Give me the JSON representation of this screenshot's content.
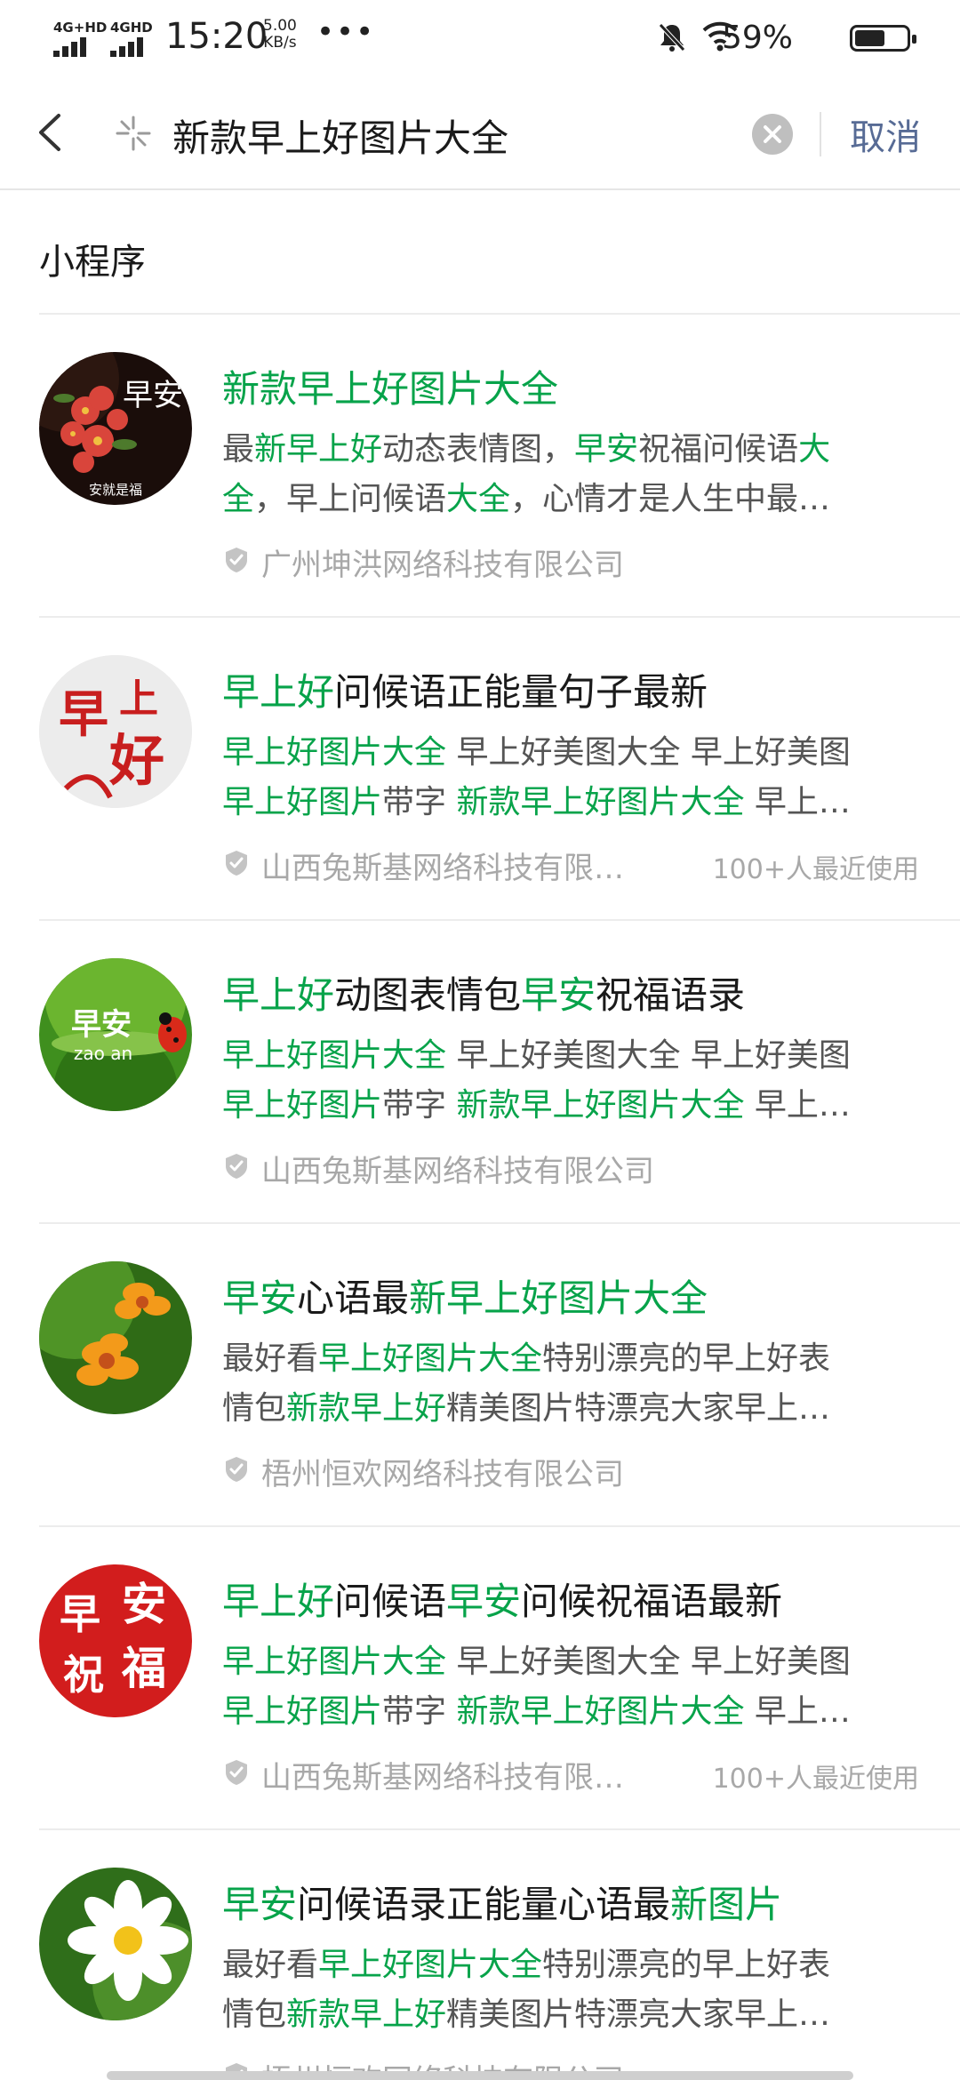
{
  "status_bar": {
    "network_1": "4G+HD",
    "network_2": "4GHD",
    "time": "15:20",
    "speed_value": "5.00",
    "speed_unit": "KB/s",
    "more": "•••",
    "battery_percent": "59%",
    "battery_level": 0.59
  },
  "search": {
    "query": "新款早上好图片大全",
    "cancel_label": "取消"
  },
  "section": {
    "title": "小程序"
  },
  "colors": {
    "highlight": "#07a34a",
    "link": "#576b95",
    "meta": "#a8a8a8"
  },
  "results": [
    {
      "icon": "red-flower-avatar",
      "avatar_text": "早安",
      "avatar_sub": "安就是福",
      "title": [
        {
          "t": "新款早上好图片大全",
          "hl": true
        }
      ],
      "desc": [
        [
          {
            "t": "最",
            "hl": false
          },
          {
            "t": "新早上好",
            "hl": true
          },
          {
            "t": "动态表情图，",
            "hl": false
          },
          {
            "t": "早安",
            "hl": true
          },
          {
            "t": "祝福问候语",
            "hl": false
          },
          {
            "t": "大",
            "hl": true
          }
        ],
        [
          {
            "t": "全",
            "hl": true
          },
          {
            "t": "，早上问候语",
            "hl": false
          },
          {
            "t": "大全",
            "hl": true
          },
          {
            "t": "，心情才是人生中最…",
            "hl": false
          }
        ]
      ],
      "company": "广州坤洪网络科技有限公司",
      "usage": ""
    },
    {
      "icon": "calligraphy-avatar",
      "avatar_text": "早上好",
      "avatar_sub": "",
      "title": [
        {
          "t": "早上好",
          "hl": true
        },
        {
          "t": "问候语正能量句子最新",
          "hl": false
        }
      ],
      "desc": [
        [
          {
            "t": "早上好图片大全",
            "hl": true
          },
          {
            "t": " 早上好美图大全 早上好美图",
            "hl": false
          }
        ],
        [
          {
            "t": "早上好图片",
            "hl": true
          },
          {
            "t": "带字 ",
            "hl": false
          },
          {
            "t": "新款早上好图片大全",
            "hl": true
          },
          {
            "t": " 早上…",
            "hl": false
          }
        ]
      ],
      "company": "山西兔斯基网络科技有限…",
      "usage": "100+人最近使用"
    },
    {
      "icon": "ladybug-avatar",
      "avatar_text": "早安",
      "avatar_sub": "zao an",
      "title": [
        {
          "t": "早上好",
          "hl": true
        },
        {
          "t": "动图表情包",
          "hl": false
        },
        {
          "t": "早安",
          "hl": true
        },
        {
          "t": "祝福语录",
          "hl": false
        }
      ],
      "desc": [
        [
          {
            "t": "早上好图片大全",
            "hl": true
          },
          {
            "t": " 早上好美图大全 早上好美图",
            "hl": false
          }
        ],
        [
          {
            "t": "早上好图片",
            "hl": true
          },
          {
            "t": "带字 ",
            "hl": false
          },
          {
            "t": "新款早上好图片大全",
            "hl": true
          },
          {
            "t": " 早上…",
            "hl": false
          }
        ]
      ],
      "company": "山西兔斯基网络科技有限公司",
      "usage": ""
    },
    {
      "icon": "orange-flower-avatar",
      "avatar_text": "",
      "avatar_sub": "",
      "title": [
        {
          "t": "早安",
          "hl": true
        },
        {
          "t": "心语最",
          "hl": false
        },
        {
          "t": "新早上好图片大全",
          "hl": true
        }
      ],
      "desc": [
        [
          {
            "t": "最好看",
            "hl": false
          },
          {
            "t": "早上好图片大全",
            "hl": true
          },
          {
            "t": "特别漂亮的早上好表",
            "hl": false
          }
        ],
        [
          {
            "t": "情包",
            "hl": false
          },
          {
            "t": "新款早上好",
            "hl": true
          },
          {
            "t": "精美图片特漂亮大家早上…",
            "hl": false
          }
        ]
      ],
      "company": "梧州恒欢网络科技有限公司",
      "usage": ""
    },
    {
      "icon": "red-seal-avatar",
      "avatar_text": "早安祝福",
      "avatar_sub": "",
      "title": [
        {
          "t": "早上好",
          "hl": true
        },
        {
          "t": "问候语",
          "hl": false
        },
        {
          "t": "早安",
          "hl": true
        },
        {
          "t": "问候祝福语最新",
          "hl": false
        }
      ],
      "desc": [
        [
          {
            "t": "早上好图片大全",
            "hl": true
          },
          {
            "t": " 早上好美图大全 早上好美图",
            "hl": false
          }
        ],
        [
          {
            "t": "早上好图片",
            "hl": true
          },
          {
            "t": "带字 ",
            "hl": false
          },
          {
            "t": "新款早上好图片大全",
            "hl": true
          },
          {
            "t": " 早上…",
            "hl": false
          }
        ]
      ],
      "company": "山西兔斯基网络科技有限…",
      "usage": "100+人最近使用"
    },
    {
      "icon": "white-daisy-avatar",
      "avatar_text": "",
      "avatar_sub": "",
      "title": [
        {
          "t": "早安",
          "hl": true
        },
        {
          "t": "问候语录正能量心语最",
          "hl": false
        },
        {
          "t": "新图片",
          "hl": true
        }
      ],
      "desc": [
        [
          {
            "t": "最好看",
            "hl": false
          },
          {
            "t": "早上好图片大全",
            "hl": true
          },
          {
            "t": "特别漂亮的早上好表",
            "hl": false
          }
        ],
        [
          {
            "t": "情包",
            "hl": false
          },
          {
            "t": "新款早上好",
            "hl": true
          },
          {
            "t": "精美图片特漂亮大家早上…",
            "hl": false
          }
        ]
      ],
      "company": "梧州恒欢网络科技有限公司",
      "usage": ""
    }
  ]
}
